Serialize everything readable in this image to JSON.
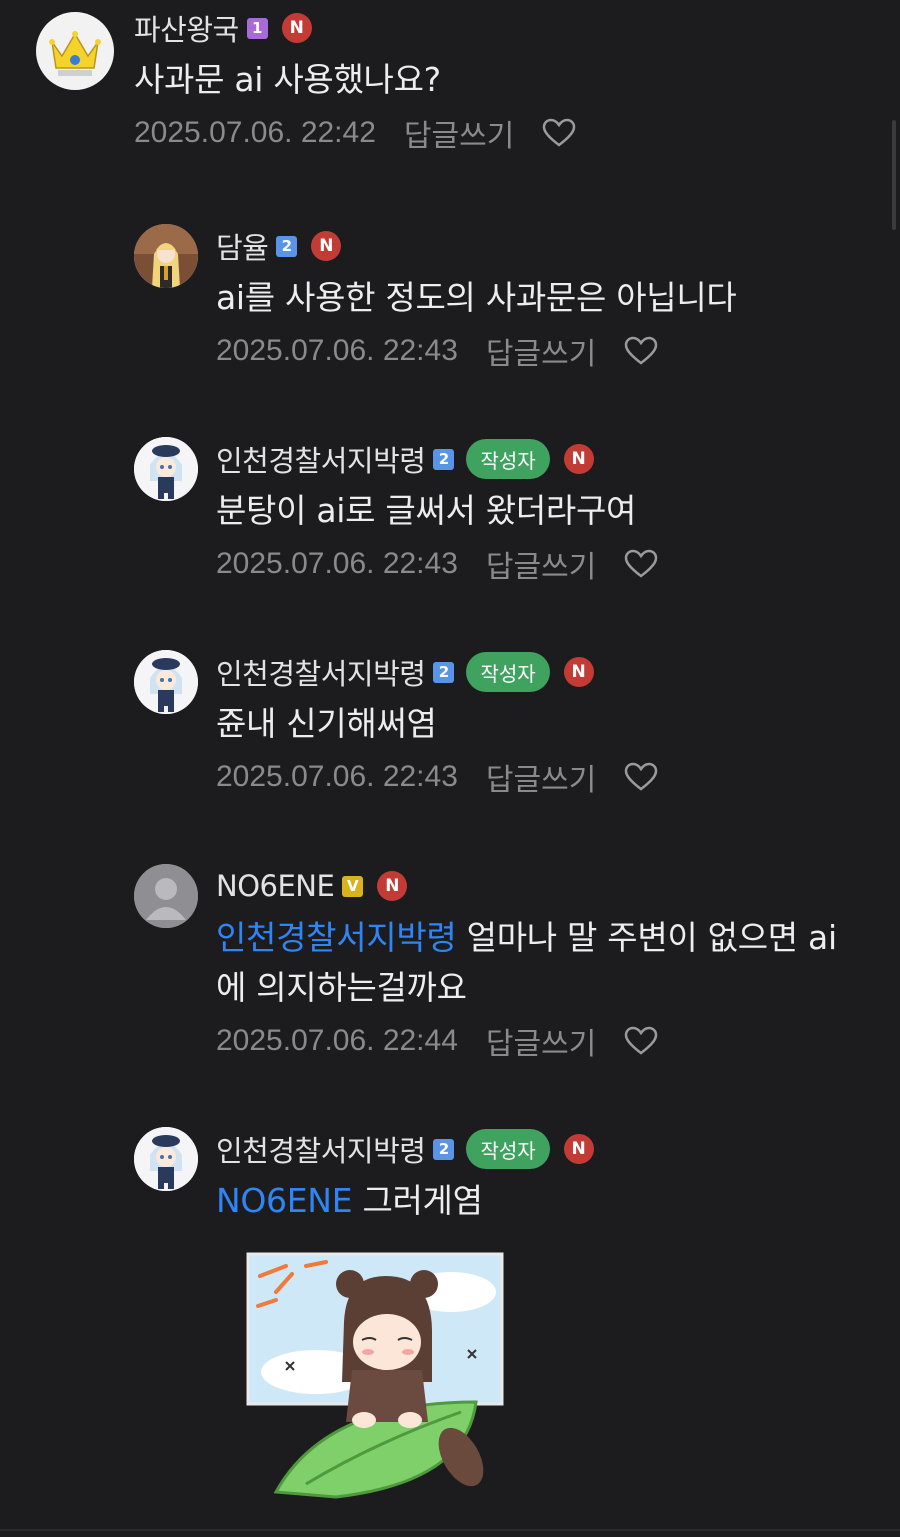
{
  "colors": {
    "background": "#1c1c1e",
    "mention": "#2f85f5",
    "author_badge": "#3fa25f",
    "new_badge": "#c23b35"
  },
  "comments": [
    {
      "nickname": "파산왕국",
      "level": "1",
      "new_badge": "N",
      "text": "사과문 ai 사용했나요?",
      "timestamp": "2025.07.06. 22:42",
      "reply_label": "답글쓰기",
      "avatar_icon": "crown-avatar"
    },
    {
      "nickname": "담율",
      "level": "2",
      "new_badge": "N",
      "text": "ai를 사용한 정도의 사과문은 아닙니다",
      "timestamp": "2025.07.06. 22:43",
      "reply_label": "답글쓰기",
      "avatar_icon": "anime-girl-avatar"
    },
    {
      "nickname": "인천경찰서지박령",
      "level": "2",
      "author_badge": "작성자",
      "new_badge": "N",
      "text": "분탕이 ai로 글써서 왔더라구여",
      "timestamp": "2025.07.06. 22:43",
      "reply_label": "답글쓰기",
      "avatar_icon": "chibi-avatar"
    },
    {
      "nickname": "인천경찰서지박령",
      "level": "2",
      "author_badge": "작성자",
      "new_badge": "N",
      "text": "쥰내 신기해써염",
      "timestamp": "2025.07.06. 22:43",
      "reply_label": "답글쓰기",
      "avatar_icon": "chibi-avatar"
    },
    {
      "nickname": "NO6ENE",
      "level": "V",
      "new_badge": "N",
      "mention": "인천경찰서지박령",
      "text_line1": " 얼마나 말 주변이 없으면 ai",
      "text_line2": "에 의지하는걸까요",
      "timestamp": "2025.07.06. 22:44",
      "reply_label": "답글쓰기",
      "avatar_icon": "default-user-avatar"
    },
    {
      "nickname": "인천경찰서지박령",
      "level": "2",
      "author_badge": "작성자",
      "new_badge": "N",
      "mention": "NO6ENE",
      "text": " 그러게염",
      "avatar_icon": "chibi-avatar",
      "sticker_icon": "raccoon-girl-sticker"
    }
  ]
}
